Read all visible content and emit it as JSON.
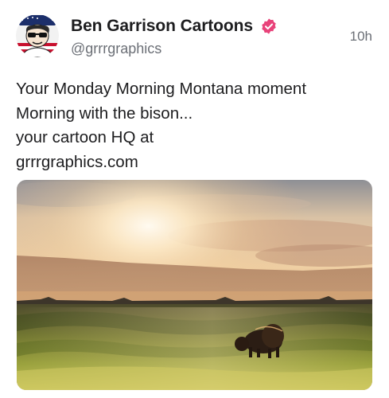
{
  "post": {
    "author": {
      "display_name": "Ben Garrison Cartoons",
      "handle": "@grrrgraphics",
      "avatar_icon": "cartoon-portrait-avatar",
      "verified_icon": "verified-badge-icon",
      "verified_color": "#e8437a"
    },
    "timestamp": "10h",
    "text_lines": [
      "Your Monday Morning Montana moment",
      "Morning with the bison...",
      "your cartoon HQ at",
      "grrrgraphics.com"
    ],
    "media": {
      "type": "photo"
    }
  },
  "colors": {
    "text_primary": "#1d1d1f",
    "text_secondary": "#6b6f76",
    "background": "#ffffff"
  }
}
